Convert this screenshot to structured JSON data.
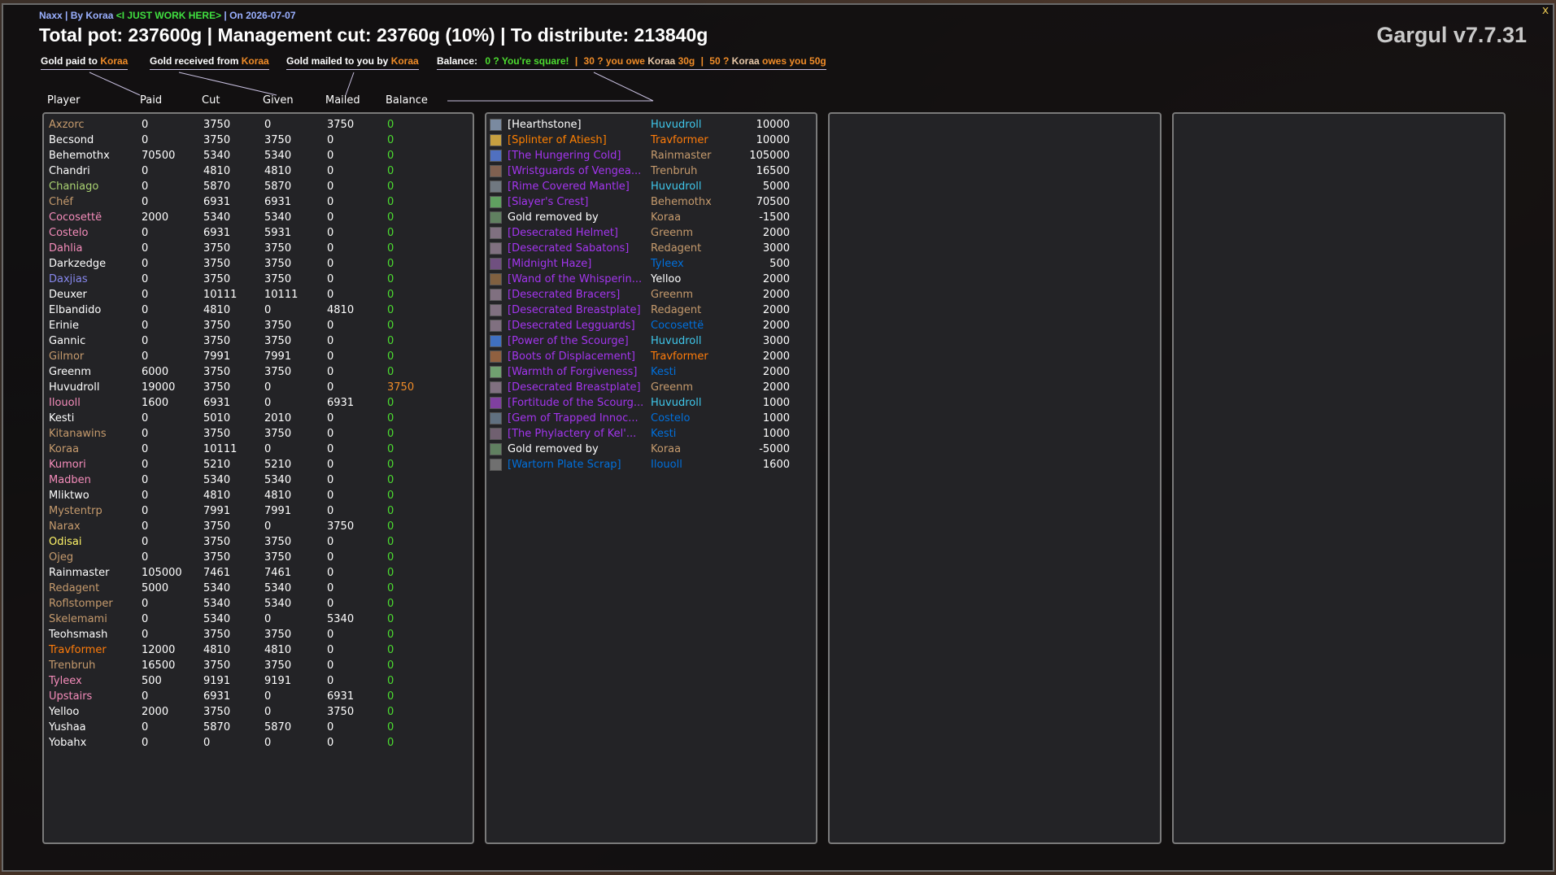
{
  "header": {
    "subtitle_parts": [
      {
        "text": "Naxx | By Koraa ",
        "color": "#9ab0ff"
      },
      {
        "text": "<I JUST WORK HERE>",
        "color": "#40e040"
      },
      {
        "text": " | On 2026-07-07",
        "color": "#9ab0ff"
      }
    ],
    "headline": "Total pot: 237600g | Management cut: 23760g (10%) | To distribute: 213840g",
    "brand": "Gargul v7.7.31",
    "close_glyph": "x"
  },
  "legend": {
    "paid_label": "Gold paid to ",
    "received_label": "Gold received from ",
    "mailed_label": "Gold mailed to you by ",
    "name": "Koraa",
    "balance_label": "Balance:",
    "square_text": "0 ? You're square!",
    "separator": "|",
    "you_owe_pre": "30 ? you owe ",
    "you_owe_amount": " 30g",
    "owes_you_pre": "50 ? ",
    "owes_you_post": " owes you 50g"
  },
  "columns": {
    "player": "Player",
    "paid": "Paid",
    "cut": "Cut",
    "given": "Given",
    "mailed": "Mailed",
    "balance": "Balance"
  },
  "colors": {
    "window_bg": "#0c0c0e",
    "panel_bg": "#232326",
    "positive": "#4cdc30",
    "owed": "#f08c28",
    "epic": "#a335ee",
    "legendary": "#ff8000",
    "mage": "#3fc7eb",
    "shaman": "#0070dd",
    "warrior": "#c69b6d",
    "paladin": "#f48cba",
    "priest": "#ffffff",
    "rogue": "#fff468",
    "warlock": "#8788ee",
    "druid": "#ff7c0a",
    "hunter": "#aad372"
  },
  "players": [
    {
      "name": "Axzorc",
      "color": "#c69b6d",
      "paid": "0",
      "cut": "3750",
      "given": "0",
      "mailed": "3750",
      "balance": "0",
      "status": "ok"
    },
    {
      "name": "Becsond",
      "color": "#ffffff",
      "paid": "0",
      "cut": "3750",
      "given": "3750",
      "mailed": "0",
      "balance": "0",
      "status": "ok"
    },
    {
      "name": "Behemothx",
      "color": "#ffffff",
      "paid": "70500",
      "cut": "5340",
      "given": "5340",
      "mailed": "0",
      "balance": "0",
      "status": "ok"
    },
    {
      "name": "Chandri",
      "color": "#ffffff",
      "paid": "0",
      "cut": "4810",
      "given": "4810",
      "mailed": "0",
      "balance": "0",
      "status": "ok"
    },
    {
      "name": "Chaniago",
      "color": "#aad372",
      "paid": "0",
      "cut": "5870",
      "given": "5870",
      "mailed": "0",
      "balance": "0",
      "status": "ok"
    },
    {
      "name": "Chéf",
      "color": "#c69b6d",
      "paid": "0",
      "cut": "6931",
      "given": "6931",
      "mailed": "0",
      "balance": "0",
      "status": "ok"
    },
    {
      "name": "Cocosettë",
      "color": "#f48cba",
      "paid": "2000",
      "cut": "5340",
      "given": "5340",
      "mailed": "0",
      "balance": "0",
      "status": "ok"
    },
    {
      "name": "Costelo",
      "color": "#f48cba",
      "paid": "0",
      "cut": "6931",
      "given": "5931",
      "mailed": "0",
      "balance": "0",
      "status": "ok"
    },
    {
      "name": "Dahlia",
      "color": "#f48cba",
      "paid": "0",
      "cut": "3750",
      "given": "3750",
      "mailed": "0",
      "balance": "0",
      "status": "ok"
    },
    {
      "name": "Darkzedge",
      "color": "#ffffff",
      "paid": "0",
      "cut": "3750",
      "given": "3750",
      "mailed": "0",
      "balance": "0",
      "status": "ok"
    },
    {
      "name": "Daxjias",
      "color": "#8788ee",
      "paid": "0",
      "cut": "3750",
      "given": "3750",
      "mailed": "0",
      "balance": "0",
      "status": "ok"
    },
    {
      "name": "Deuxer",
      "color": "#ffffff",
      "paid": "0",
      "cut": "10111",
      "given": "10111",
      "mailed": "0",
      "balance": "0",
      "status": "ok"
    },
    {
      "name": "Elbandido",
      "color": "#ffffff",
      "paid": "0",
      "cut": "4810",
      "given": "0",
      "mailed": "4810",
      "balance": "0",
      "status": "ok"
    },
    {
      "name": "Erinie",
      "color": "#ffffff",
      "paid": "0",
      "cut": "3750",
      "given": "3750",
      "mailed": "0",
      "balance": "0",
      "status": "ok"
    },
    {
      "name": "Gannic",
      "color": "#ffffff",
      "paid": "0",
      "cut": "3750",
      "given": "3750",
      "mailed": "0",
      "balance": "0",
      "status": "ok"
    },
    {
      "name": "Gilmor",
      "color": "#c69b6d",
      "paid": "0",
      "cut": "7991",
      "given": "7991",
      "mailed": "0",
      "balance": "0",
      "status": "ok"
    },
    {
      "name": "Greenm",
      "color": "#ffffff",
      "paid": "6000",
      "cut": "3750",
      "given": "3750",
      "mailed": "0",
      "balance": "0",
      "status": "ok"
    },
    {
      "name": "Huvudroll",
      "color": "#ffffff",
      "paid": "19000",
      "cut": "3750",
      "given": "0",
      "mailed": "0",
      "balance": "3750",
      "status": "owe"
    },
    {
      "name": "Ilouoll",
      "color": "#f48cba",
      "paid": "1600",
      "cut": "6931",
      "given": "0",
      "mailed": "6931",
      "balance": "0",
      "status": "ok"
    },
    {
      "name": "Kesti",
      "color": "#ffffff",
      "paid": "0",
      "cut": "5010",
      "given": "2010",
      "mailed": "0",
      "balance": "0",
      "status": "ok"
    },
    {
      "name": "Kitanawins",
      "color": "#c69b6d",
      "paid": "0",
      "cut": "3750",
      "given": "3750",
      "mailed": "0",
      "balance": "0",
      "status": "ok"
    },
    {
      "name": "Koraa",
      "color": "#c69b6d",
      "paid": "0",
      "cut": "10111",
      "given": "0",
      "mailed": "0",
      "balance": "0",
      "status": "ok"
    },
    {
      "name": "Kumori",
      "color": "#f48cba",
      "paid": "0",
      "cut": "5210",
      "given": "5210",
      "mailed": "0",
      "balance": "0",
      "status": "ok"
    },
    {
      "name": "Madben",
      "color": "#f48cba",
      "paid": "0",
      "cut": "5340",
      "given": "5340",
      "mailed": "0",
      "balance": "0",
      "status": "ok"
    },
    {
      "name": "Mliktwo",
      "color": "#ffffff",
      "paid": "0",
      "cut": "4810",
      "given": "4810",
      "mailed": "0",
      "balance": "0",
      "status": "ok"
    },
    {
      "name": "Mystentrp",
      "color": "#c69b6d",
      "paid": "0",
      "cut": "7991",
      "given": "7991",
      "mailed": "0",
      "balance": "0",
      "status": "ok"
    },
    {
      "name": "Narax",
      "color": "#c69b6d",
      "paid": "0",
      "cut": "3750",
      "given": "0",
      "mailed": "3750",
      "balance": "0",
      "status": "ok"
    },
    {
      "name": "Odisai",
      "color": "#fff468",
      "paid": "0",
      "cut": "3750",
      "given": "3750",
      "mailed": "0",
      "balance": "0",
      "status": "ok"
    },
    {
      "name": "Ojeg",
      "color": "#c69b6d",
      "paid": "0",
      "cut": "3750",
      "given": "3750",
      "mailed": "0",
      "balance": "0",
      "status": "ok"
    },
    {
      "name": "Rainmaster",
      "color": "#ffffff",
      "paid": "105000",
      "cut": "7461",
      "given": "7461",
      "mailed": "0",
      "balance": "0",
      "status": "ok"
    },
    {
      "name": "Redagent",
      "color": "#c69b6d",
      "paid": "5000",
      "cut": "5340",
      "given": "5340",
      "mailed": "0",
      "balance": "0",
      "status": "ok"
    },
    {
      "name": "Roflstomper",
      "color": "#c69b6d",
      "paid": "0",
      "cut": "5340",
      "given": "5340",
      "mailed": "0",
      "balance": "0",
      "status": "ok"
    },
    {
      "name": "Skelemami",
      "color": "#c69b6d",
      "paid": "0",
      "cut": "5340",
      "given": "0",
      "mailed": "5340",
      "balance": "0",
      "status": "ok"
    },
    {
      "name": "Teohsmash",
      "color": "#ffffff",
      "paid": "0",
      "cut": "3750",
      "given": "3750",
      "mailed": "0",
      "balance": "0",
      "status": "ok"
    },
    {
      "name": "Travformer",
      "color": "#ff7c0a",
      "paid": "12000",
      "cut": "4810",
      "given": "4810",
      "mailed": "0",
      "balance": "0",
      "status": "ok"
    },
    {
      "name": "Trenbruh",
      "color": "#c69b6d",
      "paid": "16500",
      "cut": "3750",
      "given": "3750",
      "mailed": "0",
      "balance": "0",
      "status": "ok"
    },
    {
      "name": "Tyleex",
      "color": "#f48cba",
      "paid": "500",
      "cut": "9191",
      "given": "9191",
      "mailed": "0",
      "balance": "0",
      "status": "ok"
    },
    {
      "name": "Upstairs",
      "color": "#f48cba",
      "paid": "0",
      "cut": "6931",
      "given": "0",
      "mailed": "6931",
      "balance": "0",
      "status": "ok"
    },
    {
      "name": "Yelloo",
      "color": "#ffffff",
      "paid": "2000",
      "cut": "3750",
      "given": "0",
      "mailed": "3750",
      "balance": "0",
      "status": "ok"
    },
    {
      "name": "Yushaa",
      "color": "#ffffff",
      "paid": "0",
      "cut": "5870",
      "given": "5870",
      "mailed": "0",
      "balance": "0",
      "status": "ok"
    },
    {
      "name": "Yobahx",
      "color": "#ffffff",
      "paid": "0",
      "cut": "0",
      "given": "0",
      "mailed": "0",
      "balance": "0",
      "status": "ok"
    }
  ],
  "items": [
    {
      "name": "[Hearthstone]",
      "item_color": "#ffffff",
      "icon_color": "#7a8aa0",
      "winner": "Huvudroll",
      "winner_color": "#3fc7eb",
      "price": "10000"
    },
    {
      "name": "[Splinter of Atiesh]",
      "item_color": "#ff8000",
      "icon_color": "#c8a040",
      "winner": "Travformer",
      "winner_color": "#ff7c0a",
      "price": "10000"
    },
    {
      "name": "[The Hungering Cold]",
      "item_color": "#a335ee",
      "icon_color": "#5070c0",
      "winner": "Rainmaster",
      "winner_color": "#c69b6d",
      "price": "105000"
    },
    {
      "name": "[Wristguards of Vengea...",
      "item_color": "#a335ee",
      "icon_color": "#806050",
      "winner": "Trenbruh",
      "winner_color": "#c69b6d",
      "price": "16500"
    },
    {
      "name": "[Rime Covered Mantle]",
      "item_color": "#a335ee",
      "icon_color": "#707880",
      "winner": "Huvudroll",
      "winner_color": "#3fc7eb",
      "price": "5000"
    },
    {
      "name": "[Slayer's Crest]",
      "item_color": "#a335ee",
      "icon_color": "#60a060",
      "winner": "Behemothx",
      "winner_color": "#c69b6d",
      "price": "70500"
    },
    {
      "name": "Gold removed by",
      "item_color": "#ffffff",
      "icon_color": "#608060",
      "winner": "Koraa",
      "winner_color": "#c69b6d",
      "price": "-1500"
    },
    {
      "name": "[Desecrated Helmet]",
      "item_color": "#a335ee",
      "icon_color": "#807080",
      "winner": "Greenm",
      "winner_color": "#c69b6d",
      "price": "2000"
    },
    {
      "name": "[Desecrated Sabatons]",
      "item_color": "#a335ee",
      "icon_color": "#807080",
      "winner": "Redagent",
      "winner_color": "#c69b6d",
      "price": "3000"
    },
    {
      "name": "[Midnight Haze]",
      "item_color": "#a335ee",
      "icon_color": "#705080",
      "winner": "Tyleex",
      "winner_color": "#0070dd",
      "price": "500"
    },
    {
      "name": "[Wand of the Whisperin...",
      "item_color": "#a335ee",
      "icon_color": "#806040",
      "winner": "Yelloo",
      "winner_color": "#ffffff",
      "price": "2000"
    },
    {
      "name": "[Desecrated Bracers]",
      "item_color": "#a335ee",
      "icon_color": "#807080",
      "winner": "Greenm",
      "winner_color": "#c69b6d",
      "price": "2000"
    },
    {
      "name": "[Desecrated Breastplate]",
      "item_color": "#a335ee",
      "icon_color": "#807080",
      "winner": "Redagent",
      "winner_color": "#c69b6d",
      "price": "2000"
    },
    {
      "name": "[Desecrated Legguards]",
      "item_color": "#a335ee",
      "icon_color": "#807080",
      "winner": "Cocosettë",
      "winner_color": "#0070dd",
      "price": "2000"
    },
    {
      "name": "[Power of the Scourge]",
      "item_color": "#a335ee",
      "icon_color": "#4070c0",
      "winner": "Huvudroll",
      "winner_color": "#3fc7eb",
      "price": "3000"
    },
    {
      "name": "[Boots of Displacement]",
      "item_color": "#a335ee",
      "icon_color": "#906040",
      "winner": "Travformer",
      "winner_color": "#ff7c0a",
      "price": "2000"
    },
    {
      "name": "[Warmth of Forgiveness]",
      "item_color": "#a335ee",
      "icon_color": "#70a070",
      "winner": "Kesti",
      "winner_color": "#0070dd",
      "price": "2000"
    },
    {
      "name": "[Desecrated Breastplate]",
      "item_color": "#a335ee",
      "icon_color": "#807080",
      "winner": "Greenm",
      "winner_color": "#c69b6d",
      "price": "2000"
    },
    {
      "name": "[Fortitude of the Scourg...",
      "item_color": "#a335ee",
      "icon_color": "#8040a0",
      "winner": "Huvudroll",
      "winner_color": "#3fc7eb",
      "price": "1000"
    },
    {
      "name": "[Gem of Trapped Innoc...",
      "item_color": "#a335ee",
      "icon_color": "#607080",
      "winner": "Costelo",
      "winner_color": "#0070dd",
      "price": "1000"
    },
    {
      "name": "[The Phylactery of Kel'...",
      "item_color": "#a335ee",
      "icon_color": "#706070",
      "winner": "Kesti",
      "winner_color": "#0070dd",
      "price": "1000"
    },
    {
      "name": "Gold removed by",
      "item_color": "#ffffff",
      "icon_color": "#608060",
      "winner": "Koraa",
      "winner_color": "#c69b6d",
      "price": "-5000"
    },
    {
      "name": "[Wartorn Plate Scrap]",
      "item_color": "#0070dd",
      "icon_color": "#707070",
      "winner": "Ilouoll",
      "winner_color": "#0070dd",
      "price": "1600"
    }
  ]
}
